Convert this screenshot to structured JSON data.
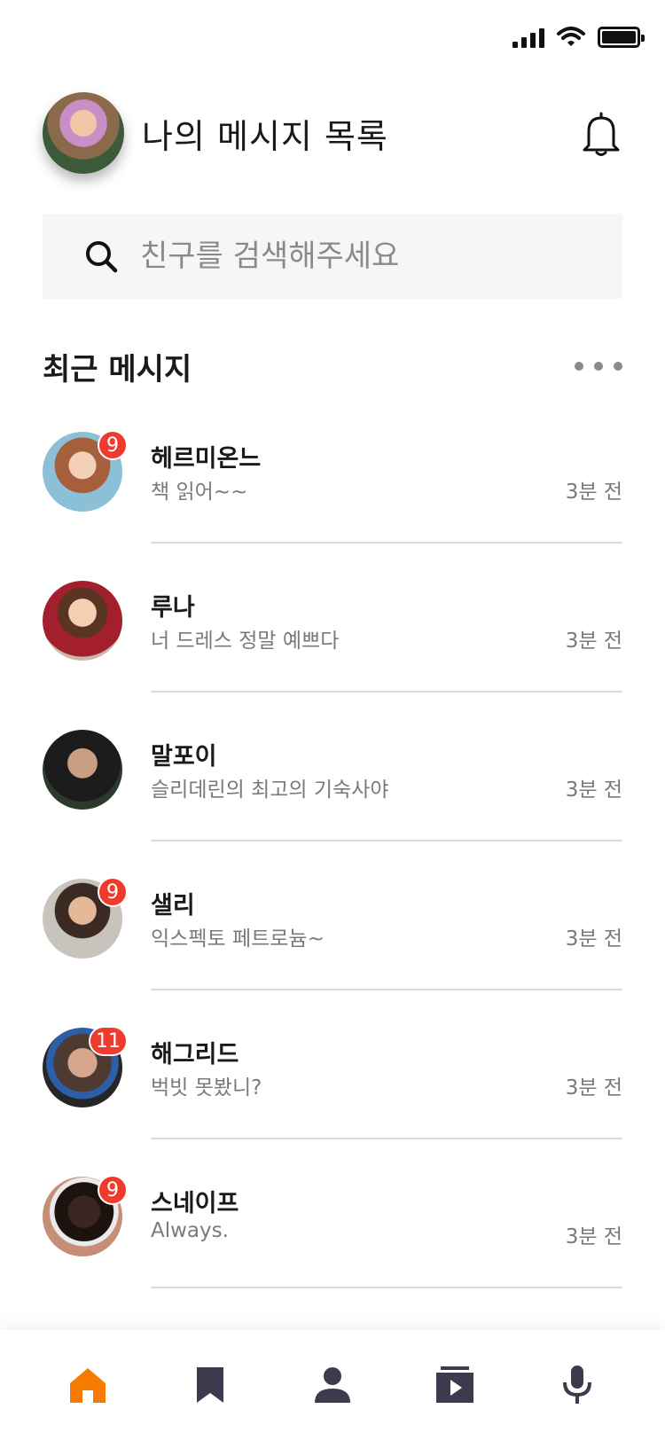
{
  "header": {
    "title": "나의 메시지 목록"
  },
  "search": {
    "placeholder": "친구를 검색해주세요"
  },
  "section": {
    "title": "최근 메시지"
  },
  "messages": [
    {
      "name": "헤르미온느",
      "preview": "책 읽어~~",
      "time": "3분 전",
      "badge": "9"
    },
    {
      "name": "루나",
      "preview": "너 드레스 정말 예쁘다",
      "time": "3분 전",
      "badge": ""
    },
    {
      "name": "말포이",
      "preview": "슬리데린의 최고의 기숙사야",
      "time": "3분 전",
      "badge": ""
    },
    {
      "name": "샐리",
      "preview": "익스펙토 페트로늄~",
      "time": "3분 전",
      "badge": "9"
    },
    {
      "name": "해그리드",
      "preview": "벅빗 못봤니?",
      "time": "3분 전",
      "badge": "11"
    },
    {
      "name": "스네이프",
      "preview": "Always.",
      "time": "3분 전",
      "badge": "9"
    }
  ],
  "colors": {
    "accent": "#f57c00",
    "badge": "#f03a2e",
    "nav_inactive": "#3d3a4d"
  },
  "icons": {
    "status": [
      "signal-icon",
      "wifi-icon",
      "battery-icon"
    ],
    "header": "bell-icon",
    "search": "search-icon",
    "nav": [
      "home-icon",
      "bookmark-icon",
      "profile-icon",
      "video-icon",
      "microphone-icon"
    ]
  }
}
